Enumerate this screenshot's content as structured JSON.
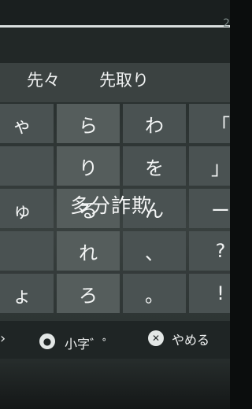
{
  "header": {
    "counter": "2"
  },
  "suggestions": [
    "先々",
    "先取り"
  ],
  "keys": [
    [
      "ゃ",
      "ら",
      "わ",
      "「"
    ],
    [
      "",
      "り",
      "を",
      "」"
    ],
    [
      "ゅ",
      "る",
      "ん",
      "ー"
    ],
    [
      "",
      "れ",
      "、",
      "?"
    ],
    [
      "ょ",
      "ろ",
      "。",
      "!"
    ]
  ],
  "overlay": {
    "text": "多分詐欺"
  },
  "footer": {
    "chevron": "›",
    "small_label": "小字゛゜",
    "cancel_label": "やめる",
    "cancel_icon": "✕"
  }
}
